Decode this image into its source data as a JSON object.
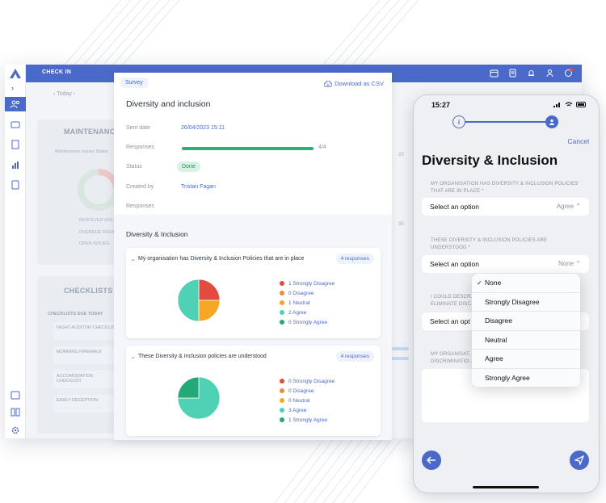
{
  "app": {
    "title": "CHECK IN",
    "date_nav": "Today",
    "maintenance_title": "MAINTENANCE",
    "maintenance_sub": "Maintenance Issues Status",
    "maintenance_legend": [
      "RESOLVED ISSUES",
      "OVERDUE ISSUES",
      "OPEN ISSUES"
    ],
    "checklists_title": "CHECKLISTS",
    "checklists_due": "CHECKLISTS DUE TODAY",
    "checklist_items": [
      "NIGHT AUDITOR CHECKLIST",
      "MORNING FIREWALK",
      "ACCOMODATION CHECKLIST",
      "EARLY RECEPTION"
    ],
    "side_numbers": [
      "23",
      "30"
    ]
  },
  "panel": {
    "tag": "Survey",
    "download_label": "Download as CSV",
    "title": "Diversity and inclusion",
    "meta": {
      "sent_date_label": "Sent date",
      "sent_date": "26/04/2023 15:11",
      "responses_label": "Responses",
      "responses_progress": 1.0,
      "responses_count": "4/4",
      "status_label": "Status",
      "status": "Done",
      "created_by_label": "Created by",
      "created_by": "Tristan Fagan",
      "responses_label_2": "Responses"
    },
    "section_title": "Diversity & Inclusion",
    "questions": [
      {
        "title": "My organisation has Diversity & Inclusion Policies that are in place",
        "responses": "4 responses",
        "legend": [
          "1 Strongly Disagree",
          "0 Disagree",
          "1 Neutral",
          "2 Agree",
          "0 Strongly Agree"
        ],
        "values": [
          1,
          0,
          1,
          2,
          0
        ]
      },
      {
        "title": "These Diversity & Inclusion policies are understood",
        "responses": "4 responses",
        "legend": [
          "0 Strongly Disagree",
          "0 Disagree",
          "0 Neutral",
          "3 Agree",
          "1 Strongly Agree"
        ],
        "values": [
          0,
          0,
          0,
          3,
          1
        ]
      }
    ],
    "colors": {
      "strongly_disagree": "#e24b3f",
      "disagree": "#f08a3c",
      "neutral": "#f5a623",
      "agree": "#4fd1b5",
      "strongly_agree": "#23a878"
    }
  },
  "phone": {
    "time": "15:27",
    "cancel": "Cancel",
    "title": "Diversity & Inclusion",
    "q1_label": "MY ORGANISATION HAS DIVERSITY & INCLUSION POLICIES THAT ARE IN PLACE *",
    "q1_select_label": "Select an option",
    "q1_value": "Agree",
    "q2_label": "THESE DIVERSITY & INCLUSION POLICIES ARE UNDERSTOOD *",
    "q2_select_label": "Select an option",
    "q2_value": "None",
    "q3_label": "I COULD DESCR... ELIMINATE DISC...",
    "q3_select_label": "Select an opt",
    "q4_label": "MY ORGANISAT... DISCRIMINATIO...",
    "dropdown": [
      "None",
      "Strongly Disagree",
      "Disagree",
      "Neutral",
      "Agree",
      "Strongly Agree"
    ],
    "dropdown_selected": "None"
  }
}
